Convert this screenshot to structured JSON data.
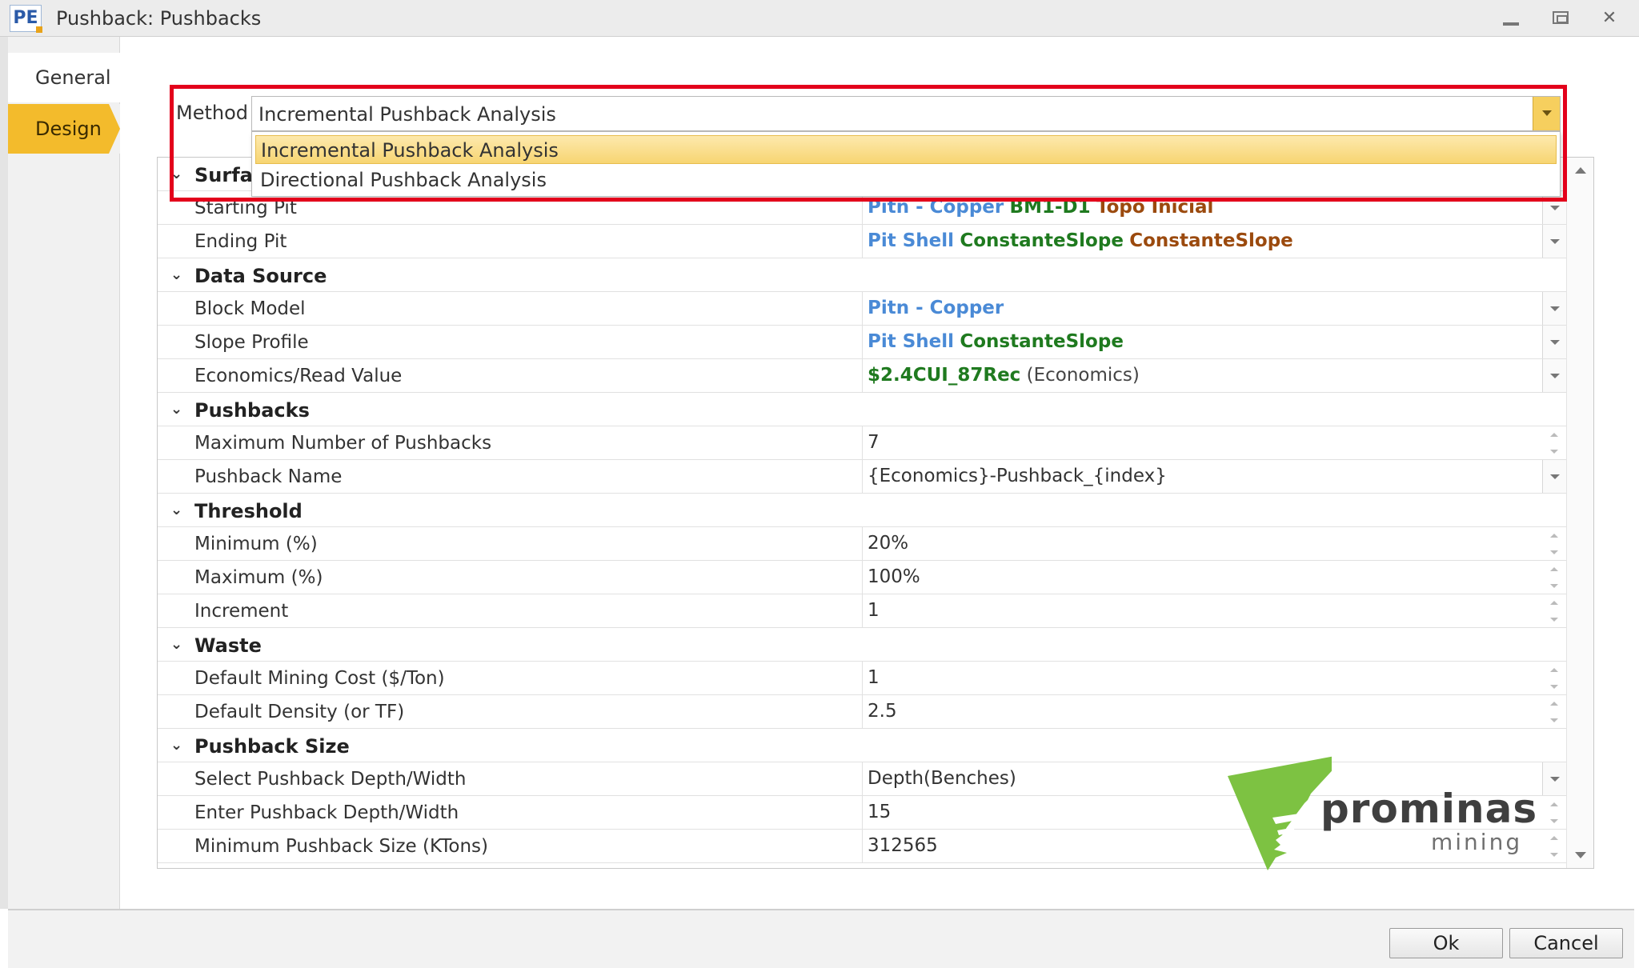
{
  "window": {
    "app_icon": "PE",
    "title": "Pushback: Pushbacks"
  },
  "nav": {
    "items": [
      {
        "label": "General",
        "active": false
      },
      {
        "label": "Design",
        "active": true
      }
    ]
  },
  "method": {
    "label": "Method",
    "value": "Incremental Pushback Analysis",
    "options": [
      "Incremental Pushback Analysis",
      "Directional Pushback Analysis"
    ],
    "highlight_color": "#e3001b"
  },
  "grid": {
    "categories": {
      "surface": "Surfac",
      "data_source": "Data Source",
      "pushbacks": "Pushbacks",
      "threshold": "Threshold",
      "waste": "Waste",
      "pushback_size": "Pushback Size"
    },
    "props": {
      "starting_pit": {
        "name": "Starting Pit",
        "v1": "Pitn - Copper",
        "v2": "BM1-D1",
        "v3": "Topo Inicial"
      },
      "ending_pit": {
        "name": "Ending Pit",
        "v1": "Pit Shell",
        "v2": "ConstanteSlope",
        "v3": "ConstanteSlope"
      },
      "block_model": {
        "name": "Block Model",
        "v1": "Pitn - Copper"
      },
      "slope_profile": {
        "name": "Slope Profile",
        "v1": "Pit Shell",
        "v2": "ConstanteSlope"
      },
      "economics": {
        "name": "Economics/Read Value",
        "v1": "$2.4CUI_87Rec",
        "v2": "(Economics)"
      },
      "max_pushbacks": {
        "name": "Maximum Number of Pushbacks",
        "value": "7"
      },
      "pushback_name": {
        "name": "Pushback Name",
        "value": "{Economics}-Pushback_{index}"
      },
      "minimum": {
        "name": "Minimum (%)",
        "value": "20%"
      },
      "maximum": {
        "name": "Maximum (%)",
        "value": "100%"
      },
      "increment": {
        "name": "Increment",
        "value": "1"
      },
      "mining_cost": {
        "name": "Default Mining Cost ($/Ton)",
        "value": "1"
      },
      "density": {
        "name": "Default Density (or TF)",
        "value": "2.5"
      },
      "select_depth": {
        "name": "Select Pushback Depth/Width",
        "value": "Depth(Benches)"
      },
      "enter_depth": {
        "name": "Enter Pushback Depth/Width",
        "value": "15"
      },
      "min_size": {
        "name": "Minimum Pushback Size (KTons)",
        "value": "312565"
      }
    },
    "colors": {
      "blue": "#4a8ad6",
      "green": "#1f7a1f",
      "brown": "#9b4a0e"
    }
  },
  "footer": {
    "ok": "Ok",
    "cancel": "Cancel"
  },
  "watermark": {
    "word": "prominas",
    "sub": "mining",
    "color": "#7dc242"
  }
}
